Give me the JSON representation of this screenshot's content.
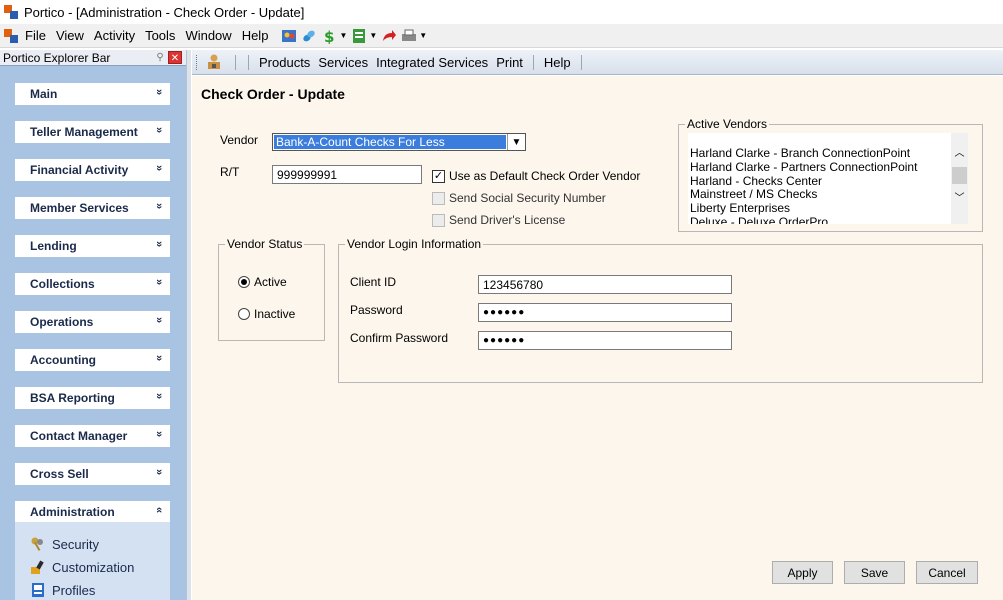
{
  "window": {
    "title": "Portico - [Administration - Check Order - Update]"
  },
  "menu": [
    "File",
    "View",
    "Activity",
    "Tools",
    "Window",
    "Help"
  ],
  "toolbar_icons": [
    "members-icon",
    "link-icon",
    "money-icon",
    "report-icon",
    "redo-arrow-icon",
    "print-icon"
  ],
  "explorer": {
    "title": "Portico Explorer Bar",
    "groups": [
      {
        "label": "Main",
        "chevron": "»"
      },
      {
        "label": "Teller Management",
        "chevron": "»"
      },
      {
        "label": "Financial Activity",
        "chevron": "»"
      },
      {
        "label": "Member Services",
        "chevron": "»"
      },
      {
        "label": "Lending",
        "chevron": "»"
      },
      {
        "label": "Collections",
        "chevron": "»"
      },
      {
        "label": "Operations",
        "chevron": "»"
      },
      {
        "label": "Accounting",
        "chevron": "»"
      },
      {
        "label": "BSA Reporting",
        "chevron": "»"
      },
      {
        "label": "Contact Manager",
        "chevron": "»"
      },
      {
        "label": "Cross Sell",
        "chevron": "»"
      },
      {
        "label": "Administration",
        "chevron": "«"
      }
    ],
    "admin_links": [
      "Security",
      "Customization",
      "Profiles"
    ]
  },
  "content_toolbar": [
    "Products",
    "Services",
    "Integrated Services",
    "Print",
    "Help"
  ],
  "form": {
    "title": "Check Order - Update",
    "vendor_label": "Vendor",
    "vendor_value": "Bank-A-Count Checks For Less",
    "rt_label": "R/T",
    "rt_value": "999999991",
    "default_vendor_label": "Use as Default Check Order Vendor",
    "default_vendor_checked": true,
    "ssn_label": "Send Social Security Number",
    "dl_label": "Send Driver's License",
    "active_vendors_label": "Active Vendors",
    "active_vendors": [
      "Harland Clarke - Branch ConnectionPoint",
      "Harland Clarke - Partners ConnectionPoint",
      "Harland - Checks Center",
      "Mainstreet / MS Checks",
      "Liberty Enterprises",
      "Deluxe - Deluxe OrderPro"
    ],
    "vendor_status_label": "Vendor Status",
    "status_active": "Active",
    "status_inactive": "Inactive",
    "login_label": "Vendor Login Information",
    "client_id_label": "Client ID",
    "client_id_value": "123456780",
    "password_label": "Password",
    "password_value": "●●●●●●",
    "confirm_label": "Confirm Password",
    "confirm_value": "●●●●●●"
  },
  "buttons": {
    "apply": "Apply",
    "save": "Save",
    "cancel": "Cancel"
  }
}
